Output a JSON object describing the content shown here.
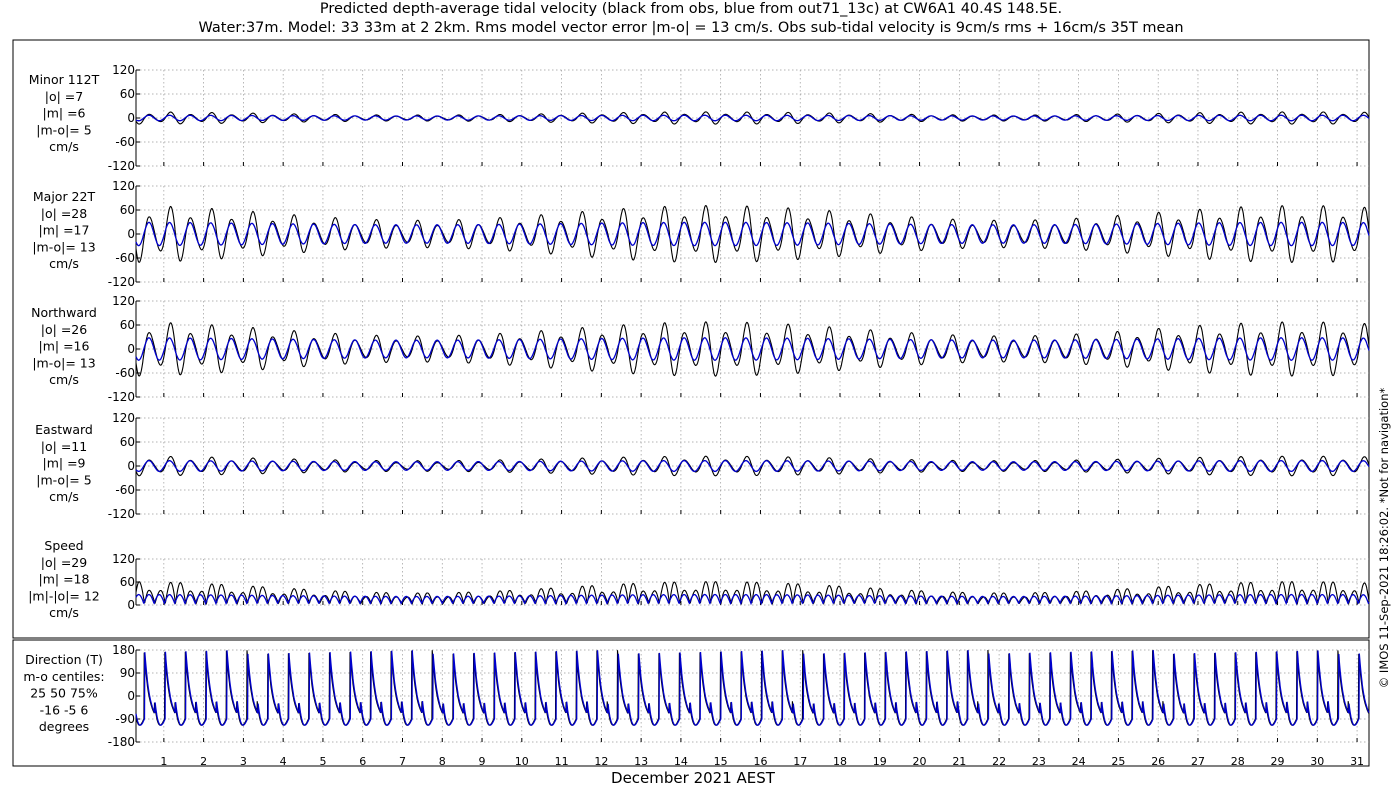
{
  "figure": {
    "title_line1": "Predicted depth-average tidal velocity (black from obs, blue from out71_13c) at CW6A1 40.4S 148.5E.",
    "title_line2": "Water:37m. Model: 33 33m at 2 2km. Rms model vector error |m-o| = 13 cm/s. Obs sub-tidal velocity is 9cm/s rms + 16cm/s 35T mean",
    "xlabel": "December 2021 AEST",
    "credit": "© IMOS 11-Sep-2021 18:26:02. *Not for navigation*",
    "colors": {
      "obs": "#000000",
      "model": "#0000cc",
      "grid": "#9a9a9a"
    }
  },
  "chart_data": [
    {
      "type": "line",
      "panel": "minor",
      "label_lines": [
        "Minor 112T",
        "|o| =7",
        "|m| =6",
        "|m-o|= 5",
        "cm/s"
      ],
      "ylim": [
        -120,
        120
      ],
      "yticks": [
        "120",
        "60",
        "0",
        "-60",
        "-120"
      ],
      "xlim": [
        0.3,
        31.3
      ],
      "x_ticks": [
        "1",
        "2",
        "3",
        "4",
        "5",
        "6",
        "7",
        "8",
        "9",
        "10",
        "11",
        "12",
        "13",
        "14",
        "15",
        "16",
        "17",
        "18",
        "19",
        "20",
        "21",
        "22",
        "23",
        "24",
        "25",
        "26",
        "27",
        "28",
        "29",
        "30",
        "31"
      ],
      "series": [
        {
          "role": "obs",
          "amplitude_cm_s": 9,
          "mean_cm_s": 0,
          "spring_neap_modulation": 0.35
        },
        {
          "role": "model",
          "amplitude_cm_s": 6,
          "mean_cm_s": 0,
          "spring_neap_modulation": 0.15
        }
      ]
    },
    {
      "type": "line",
      "panel": "major",
      "label_lines": [
        "Major 22T",
        "|o| =28",
        "|m| =17",
        "|m-o|= 13",
        "cm/s"
      ],
      "ylim": [
        -120,
        120
      ],
      "yticks": [
        "120",
        "60",
        "0",
        "-60",
        "-120"
      ],
      "xlim": [
        0.3,
        31.3
      ],
      "series": [
        {
          "role": "obs",
          "amplitude_cm_s": 42,
          "mean_cm_s": 0,
          "spring_neap_modulation": 0.35
        },
        {
          "role": "model",
          "amplitude_cm_s": 26,
          "mean_cm_s": 0,
          "spring_neap_modulation": 0.12
        }
      ]
    },
    {
      "type": "line",
      "panel": "northward",
      "label_lines": [
        "Northward",
        "|o| =26",
        "|m| =16",
        "|m-o|= 13",
        "cm/s"
      ],
      "ylim": [
        -120,
        120
      ],
      "yticks": [
        "120",
        "60",
        "0",
        "-60",
        "-120"
      ],
      "xlim": [
        0.3,
        31.3
      ],
      "series": [
        {
          "role": "obs",
          "amplitude_cm_s": 40,
          "mean_cm_s": 0,
          "spring_neap_modulation": 0.35
        },
        {
          "role": "model",
          "amplitude_cm_s": 25,
          "mean_cm_s": 0,
          "spring_neap_modulation": 0.12
        }
      ]
    },
    {
      "type": "line",
      "panel": "eastward",
      "label_lines": [
        "Eastward",
        "|o| =11",
        "|m| =9",
        "|m-o|= 5",
        "cm/s"
      ],
      "ylim": [
        -120,
        120
      ],
      "yticks": [
        "120",
        "60",
        "0",
        "-60",
        "-120"
      ],
      "xlim": [
        0.3,
        31.3
      ],
      "series": [
        {
          "role": "obs",
          "amplitude_cm_s": 15,
          "mean_cm_s": 0,
          "spring_neap_modulation": 0.3
        },
        {
          "role": "model",
          "amplitude_cm_s": 12,
          "mean_cm_s": 0,
          "spring_neap_modulation": 0.12
        }
      ]
    },
    {
      "type": "line",
      "panel": "speed",
      "label_lines": [
        "Speed",
        "|o| =29",
        "|m| =18",
        "|m|-|o|= 12",
        "cm/s"
      ],
      "ylim": [
        0,
        120
      ],
      "yticks": [
        "120",
        "60",
        "0"
      ],
      "xlim": [
        0.3,
        31.3
      ],
      "series": [
        {
          "role": "obs",
          "amplitude_cm_s": 42,
          "mean_cm_s": 0,
          "spring_neap_modulation": 0.35
        },
        {
          "role": "model",
          "amplitude_cm_s": 26,
          "mean_cm_s": 0,
          "spring_neap_modulation": 0.12
        }
      ]
    },
    {
      "type": "line",
      "panel": "direction",
      "label_lines": [
        "Direction (T)",
        "m-o centiles:",
        "25  50  75%",
        "-16  -5   6",
        "degrees"
      ],
      "ylim": [
        -180,
        180
      ],
      "yticks": [
        "180",
        "90",
        "0",
        "-90",
        "-180"
      ],
      "xlim": [
        0.3,
        31.3
      ],
      "series": [
        {
          "role": "obs",
          "major_axis_deg": 22,
          "sawtooth": true
        },
        {
          "role": "model",
          "major_axis_deg": 22,
          "sawtooth": true
        }
      ]
    }
  ]
}
